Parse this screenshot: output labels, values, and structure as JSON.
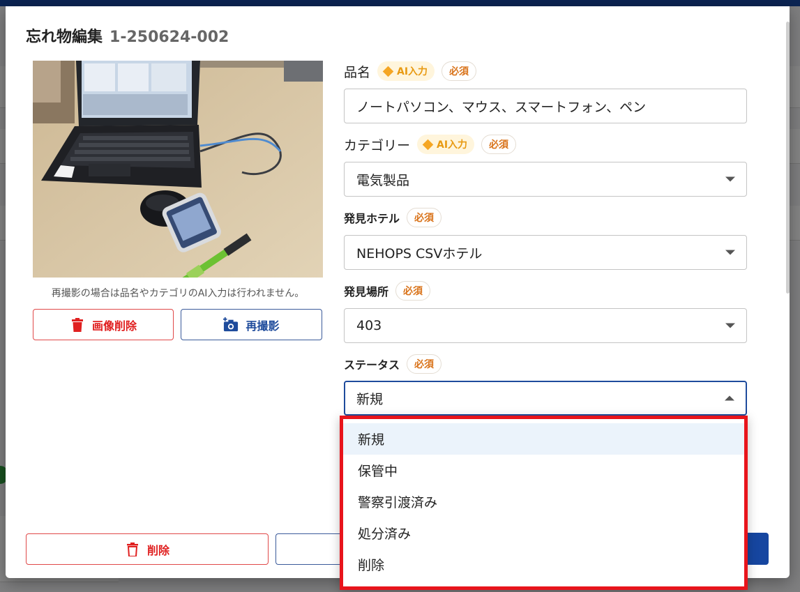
{
  "dialog": {
    "title": "忘れ物編集",
    "record_id": "1-250624-002"
  },
  "photo": {
    "note": "再撮影の場合は品名やカテゴリのAI入力は行われません。",
    "delete_image_label": "画像削除",
    "retake_label": "再撮影"
  },
  "badges": {
    "ai": "AI入力",
    "required": "必須"
  },
  "form": {
    "item_name": {
      "label": "品名",
      "value": "ノートパソコン、マウス、スマートフォン、ペン"
    },
    "category": {
      "label": "カテゴリー",
      "value": "電気製品"
    },
    "hotel": {
      "label": "発見ホテル",
      "value": "NEHOPS CSVホテル"
    },
    "location": {
      "label": "発見場所",
      "value": "403"
    },
    "status": {
      "label": "ステータス",
      "value": "新規",
      "options": [
        "新規",
        "保管中",
        "警察引渡済み",
        "処分済み",
        "削除"
      ]
    }
  },
  "footer": {
    "delete_label": "削除"
  },
  "colors": {
    "primary": "#1646a0",
    "danger": "#e02020",
    "ai_badge": "#f5a623",
    "required_badge": "#d9731a",
    "highlight_border": "#e8141b"
  }
}
